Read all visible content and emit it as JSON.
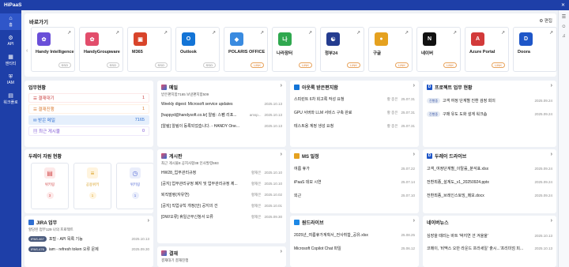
{
  "app": {
    "brand": "HiPaaS"
  },
  "sidebar": [
    {
      "icon": "⌂",
      "label": "홈"
    },
    {
      "icon": "⚙",
      "label": "API"
    },
    {
      "icon": "▦",
      "label": "엔티티"
    },
    {
      "icon": "⛨",
      "label": "IAM"
    },
    {
      "icon": "▤",
      "label": "워크플로"
    }
  ],
  "favorites": {
    "title": "바로가기",
    "edit": "편집",
    "cards": [
      {
        "name": "Handy Intelligence",
        "tag": "SSO",
        "color": "#6a4fd8",
        "glyph": "✿"
      },
      {
        "name": "HandyGroupware",
        "tag": "SSO",
        "color": "#e24d6b",
        "glyph": "✿"
      },
      {
        "name": "M365",
        "tag": "SSO",
        "color": "#d8442a",
        "glyph": "▣"
      },
      {
        "name": "Outlook",
        "tag": "SSO",
        "color": "#1374d6",
        "glyph": "O"
      },
      {
        "name": "POLARIS OFFICE",
        "tag": "LINK",
        "color": "#3a8be0",
        "glyph": "◆"
      },
      {
        "name": "나라장터",
        "tag": "LINK",
        "color": "#2fa84f",
        "glyph": "나"
      },
      {
        "name": "정부24",
        "tag": "LINK",
        "color": "#243c8f",
        "glyph": "☯"
      },
      {
        "name": "구글",
        "tag": "LINK",
        "color": "#e5a11f",
        "glyph": "●"
      },
      {
        "name": "네이버",
        "tag": "LINK",
        "color": "#111111",
        "glyph": "N"
      },
      {
        "name": "Azure Portal",
        "tag": "LINK",
        "color": "#d23a3a",
        "glyph": "A"
      },
      {
        "name": "Doora",
        "tag": "",
        "color": "#1e56c8",
        "glyph": "D"
      }
    ]
  },
  "workstatus": {
    "title": "업무현황",
    "items": [
      {
        "label": "결재대기",
        "count": "1",
        "bg": "#fde9e9",
        "fg": "#c93b3b",
        "cbg": "#fff",
        "icon": "☰"
      },
      {
        "label": "결재진행",
        "count": "1",
        "bg": "#fff1e4",
        "fg": "#d9782e",
        "cbg": "#fff",
        "icon": "☰"
      },
      {
        "label": "받은 메일",
        "count": "7165",
        "bg": "#e5effc",
        "fg": "#2f6fd1",
        "cbg": "#e5effc",
        "icon": "✉"
      },
      {
        "label": "최근 게시물",
        "count": "0",
        "bg": "#efe9fb",
        "fg": "#7a4fd3",
        "cbg": "#fff",
        "icon": "▤"
      }
    ]
  },
  "duray": {
    "title": "두레이 자원 현황",
    "items": [
      {
        "label": "위키링",
        "count": "3",
        "color": "#d24b4b",
        "bg": "#fde9e9",
        "icon": "▤"
      },
      {
        "label": "공용위키",
        "count": "1",
        "color": "#d9a024",
        "bg": "#fff4de",
        "icon": "≡"
      },
      {
        "label": "위키링",
        "count": "1",
        "color": "#5a6fd6",
        "bg": "#eaeefb",
        "icon": "◷"
      }
    ]
  },
  "jira": {
    "title": "JIRA 업무",
    "tabs": "할당된 업무129  나의 프로젝트",
    "rows": [
      {
        "id": "IPAS-467",
        "text": "포털 - API 목록 기능",
        "date": "2025.10.13"
      },
      {
        "id": "IPAS-476",
        "text": "iam - refresh token 오류 문제",
        "date": "2025.09.30"
      }
    ]
  },
  "mail": {
    "title": "메일",
    "tabs": "받은편지함7165  보낸편지함509",
    "rows": [
      {
        "text": "Weekly digest: Microsoft service updates",
        "author": "",
        "date": "2025.10.13"
      },
      {
        "text": "[happyd@handysoft.co.kr] 알림: 스팸 리포...",
        "author": "amsp...",
        "date": "2025.10.13"
      },
      {
        "text": "[알림] 알림이 등록되었습니다. - HANDY One...",
        "author": "",
        "date": "2025.10.13"
      }
    ]
  },
  "board": {
    "title": "게시판",
    "tabs": "최근 게시물8  공지사항38  인사발령593",
    "rows": [
      {
        "text": "HW28_업무관리규정",
        "author": "황재은",
        "date": "2025.10.10"
      },
      {
        "text": "[공지] 업무관리규정 폐지 및 업무관리규정 제...",
        "author": "황재은",
        "date": "2025.10.10"
      },
      {
        "text": "퇴직발령(자유연)",
        "author": "황재은",
        "date": "2025.10.02"
      },
      {
        "text": "[공지] 직업규칙 개정(안) 공지의 건",
        "author": "황재은",
        "date": "2025.10.01"
      },
      {
        "text": "[DW/오류] 휴일근무신청서 오류",
        "author": "황재은",
        "date": "2025.09.30"
      }
    ]
  },
  "approval": {
    "title": "결재",
    "tabs": "결재대기  결재진행"
  },
  "outlook": {
    "title": "아웃룩 받은편지함",
    "rows": [
      {
        "text": "스피린트 6차 회고록 작성 요청",
        "author": "황 종은",
        "date": "25.07.31"
      },
      {
        "text": "GPU 서버와 LLM 서비스 구축 완료",
        "author": "황 종은",
        "date": "25.07.31"
      },
      {
        "text": "테스트용 계정 생성 요청",
        "author": "황 종은",
        "date": "25.07.31"
      }
    ]
  },
  "ms": {
    "title": "MS 일정",
    "rows": [
      {
        "text": "여름 휴가",
        "date": "25.07.22"
      },
      {
        "text": "iPaaS 데모 시연",
        "date": "25.07.14"
      },
      {
        "text": "외근",
        "date": "25.07.10"
      }
    ]
  },
  "onedrive": {
    "title": "원드라이브",
    "rows": [
      {
        "text": "2025년_여름휴가계획서_전사취합_공유.xlsx",
        "date": "25.08.25"
      },
      {
        "text": "Microsoft Copilot Chat 파일",
        "date": "25.06.12"
      }
    ]
  },
  "project": {
    "title": "프로젝트 업무 현황",
    "rows": [
      {
        "pill": "진행중",
        "text": "고객 여정 단계별 진환 검정 회의",
        "date": "2025.09.24"
      },
      {
        "pill": "진행중",
        "text": "구매 유도 도화 설계 워크숍",
        "date": "2025.09.24"
      }
    ]
  },
  "drive": {
    "title": "두레이 드라이브",
    "rows": [
      {
        "text": "고객_여정단계별_이탈률_분석표.xlsx",
        "date": "2025.09.24"
      },
      {
        "text": "전환최종_설계도_v1_20250924.pptx",
        "date": "2025.09.24"
      },
      {
        "text": "전환최종_브레인스토밍_메모.docx",
        "date": "2025.09.24"
      }
    ]
  },
  "news": {
    "title": "네이버뉴스",
    "rows": [
      {
        "text": "심장을 때리는 바트 '박지연 션 겨울울'",
        "date": "2025.10.13"
      },
      {
        "text": "코메이, '비맥스 오만 라운드 프라세일' 출시...'프리미엄 피...",
        "date": "2025.10.13"
      }
    ]
  }
}
